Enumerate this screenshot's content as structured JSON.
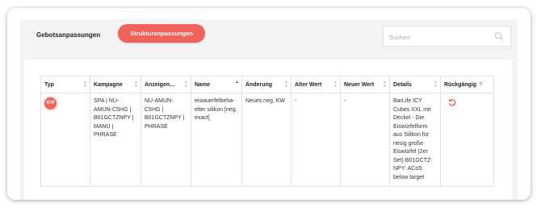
{
  "tabs": {
    "gebot_label": "Gebotsanpassungen",
    "struktur_label": "Strukturanpassungen"
  },
  "search": {
    "placeholder": "Suchen"
  },
  "table": {
    "headers": [
      "Typ",
      "Kampagne",
      "Anzeigen…",
      "Name",
      "Änderung",
      "Alter Wert",
      "Neuer Wert",
      "Details",
      "Rückgängig"
    ],
    "help_mark": "?",
    "rows": [
      {
        "type_badge": "KW",
        "kampagne": "SPA | NU-AMUN-C5HG | B01GCTZNPY | MANU | PHRASE",
        "anzeigengruppe": "NU-AMUN-C5HG | B01GCTZNPY | PHRASE",
        "name": "eiswuerfelbeha-elter silikon [neg. exact]",
        "aenderung": "Neues neg. KW",
        "alter_wert": "-",
        "neuer_wert": "-",
        "details": "BarLife ICY Cubes XXL mit Deckel - Die Eiswürfelform aus Silikon für riesig große Eiswürfel (2er Set) B01GCTZ-NPY: ACoS below target"
      }
    ]
  },
  "colors": {
    "accent": "#f0625a"
  },
  "icons": {
    "search": "search-icon",
    "undo": "undo-icon"
  }
}
